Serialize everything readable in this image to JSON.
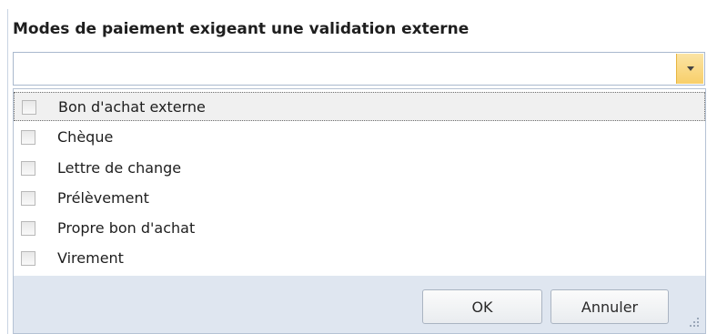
{
  "dialog": {
    "title": "Modes de paiement exigeant une validation externe",
    "combo_value": "",
    "items": [
      {
        "label": "Bon d'achat externe",
        "checked": false,
        "selected": true
      },
      {
        "label": "Chèque",
        "checked": false,
        "selected": false
      },
      {
        "label": "Lettre de change",
        "checked": false,
        "selected": false
      },
      {
        "label": "Prélèvement",
        "checked": false,
        "selected": false
      },
      {
        "label": "Propre bon d'achat",
        "checked": false,
        "selected": false
      },
      {
        "label": "Virement",
        "checked": false,
        "selected": false
      }
    ],
    "ok_label": "OK",
    "cancel_label": "Annuler"
  },
  "colors": {
    "accent_arrow": "#f8cf6a",
    "border": "#a9b8cd",
    "footer_bg": "#dfe6f0"
  }
}
